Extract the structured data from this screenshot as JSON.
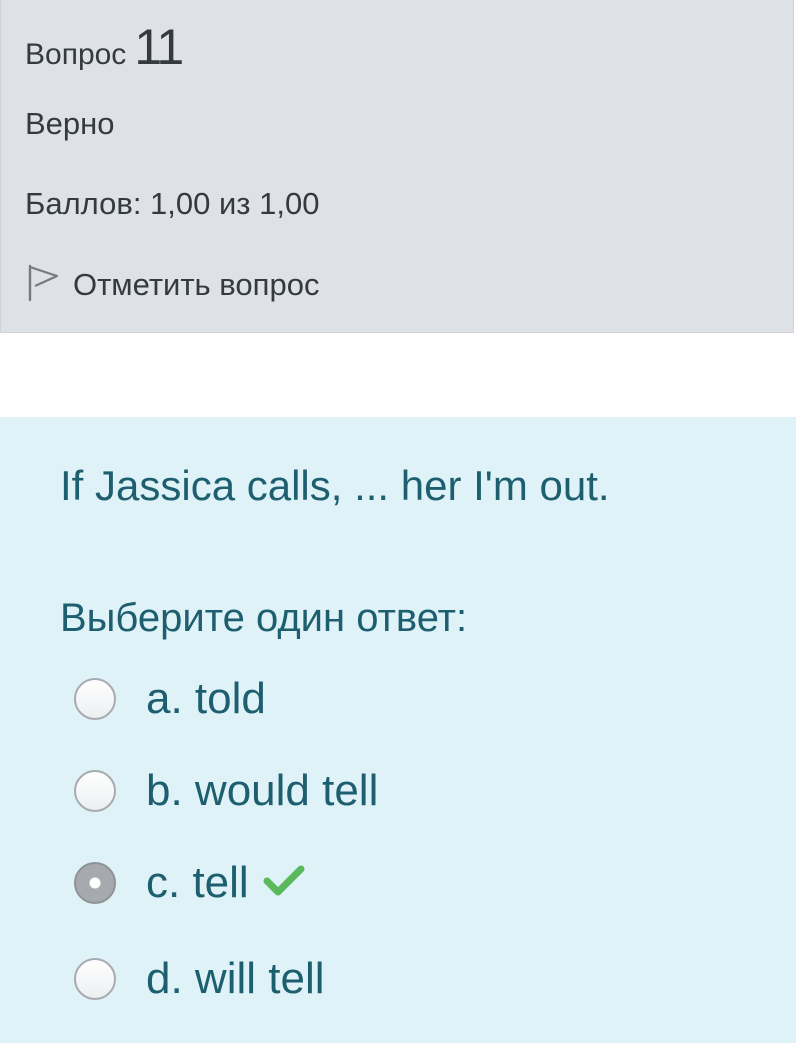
{
  "info": {
    "question_label": "Вопрос",
    "question_number": "11",
    "state": "Верно",
    "grade": "Баллов: 1,00 из 1,00",
    "flag_label": "Отметить вопрос",
    "flag_icon": "flag-icon"
  },
  "question": {
    "text": "If Jassica calls, ... her I'm out.",
    "prompt": "Выберите один ответ:",
    "options": [
      {
        "label": "a. told",
        "selected": false
      },
      {
        "label": "b. would tell",
        "selected": false
      },
      {
        "label": "c. tell",
        "selected": true,
        "correct": true
      },
      {
        "label": "d. will tell",
        "selected": false
      }
    ],
    "correct_icon": "check-icon"
  },
  "colors": {
    "info_bg": "#dee2e6",
    "question_bg": "#def2f8",
    "text_primary": "#1e5f6f",
    "correct_green": "#5cb85c"
  }
}
